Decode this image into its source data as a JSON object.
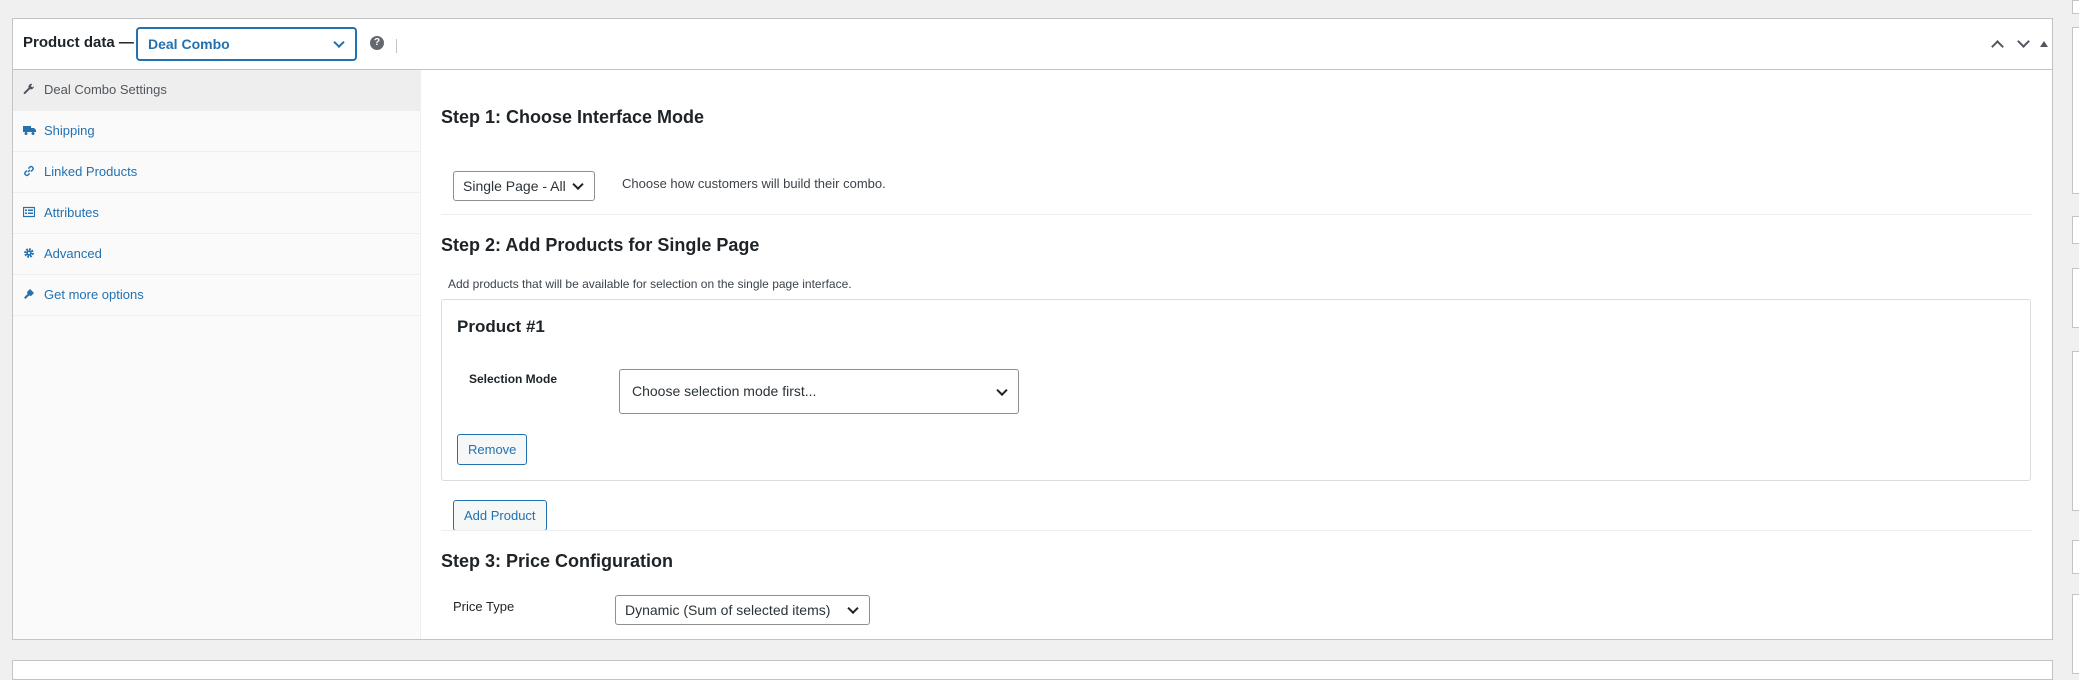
{
  "header": {
    "title": "Product data —",
    "product_type": "Deal Combo",
    "help": "?"
  },
  "sidebar": {
    "items": [
      {
        "label": "Deal Combo Settings",
        "icon": "wrench-icon",
        "active": true
      },
      {
        "label": "Shipping",
        "icon": "truck-icon",
        "active": false
      },
      {
        "label": "Linked Products",
        "icon": "link-icon",
        "active": false
      },
      {
        "label": "Attributes",
        "icon": "list-icon",
        "active": false
      },
      {
        "label": "Advanced",
        "icon": "gear-icon",
        "active": false
      },
      {
        "label": "Get more options",
        "icon": "plugin-icon",
        "active": false
      }
    ]
  },
  "step1": {
    "title": "Step 1: Choose Interface Mode",
    "mode_value": "Single Page - All",
    "mode_help": "Choose how customers will build their combo."
  },
  "step2": {
    "title": "Step 2: Add Products for Single Page",
    "description": "Add products that will be available for selection on the single page interface.",
    "product_title": "Product #1",
    "selection_mode_label": "Selection Mode",
    "selection_mode_value": "Choose selection mode first...",
    "remove_label": "Remove",
    "add_product_label": "Add Product"
  },
  "step3": {
    "title": "Step 3: Price Configuration",
    "price_type_label": "Price Type",
    "price_type_value": "Dynamic (Sum of selected items)"
  },
  "colors": {
    "accent": "#2271b1",
    "border": "#c3c4c7",
    "background": "#f0f0f1"
  }
}
